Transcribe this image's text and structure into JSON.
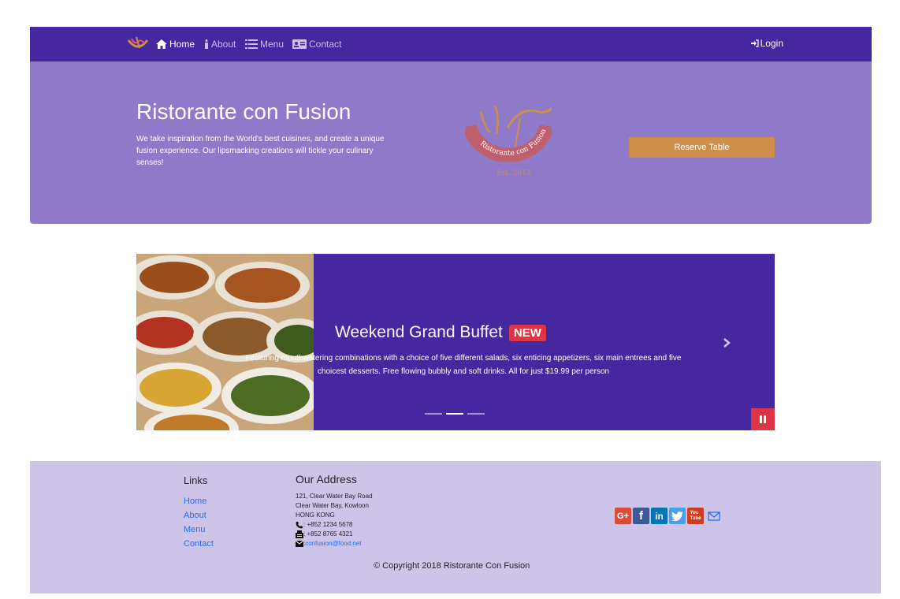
{
  "nav": {
    "items": [
      {
        "label": "Home",
        "icon": "home-icon",
        "active": true
      },
      {
        "label": "About",
        "icon": "info-icon"
      },
      {
        "label": "Menu",
        "icon": "list-icon"
      },
      {
        "label": "Contact",
        "icon": "address-card-icon"
      }
    ],
    "login_label": "Login",
    "brand_icon": "restaurant-logo-icon"
  },
  "hero": {
    "title": "Ristorante con Fusion",
    "description": "We take inspiration from the World's best cuisines, and create a unique fusion experience. Our lipsmacking creations will tickle your culinary senses!",
    "logo_text": "Ristorante con Fusion",
    "logo_est": "Est. 2013",
    "reserve_label": "Reserve Table"
  },
  "carousel": {
    "title": "Weekend Grand Buffet",
    "badge": "NEW",
    "description": "Featuring mouthwatering combinations with a choice of five different salads, six enticing appetizers, six main entrees and five choicest desserts. Free flowing bubbly and soft drinks. All for just $19.99 per person",
    "active_indicator": 1,
    "indicator_count": 3
  },
  "footer": {
    "links_heading": "Links",
    "links": [
      "Home",
      "About",
      "Menu",
      "Contact"
    ],
    "address_heading": "Our Address",
    "address_lines": [
      "121, Clear Water Bay Road",
      "Clear Water Bay, Kowloon",
      "HONG KONG"
    ],
    "phone": ": +852 1234 5678",
    "fax": ": +852 8765 4321",
    "email": "confusion@food.net",
    "copyright": "© Copyright 2018 Ristorante Con Fusion",
    "social": [
      "G+",
      "f",
      "in",
      "twitter",
      "YouTube",
      "mail"
    ]
  },
  "colors": {
    "navbar": "#4527a0",
    "jumbotron": "#8e7ac8",
    "reserve_button": "#d08e4b",
    "badge": "#dc3545",
    "footer": "#cec3e9",
    "link": "#1e6fff"
  }
}
